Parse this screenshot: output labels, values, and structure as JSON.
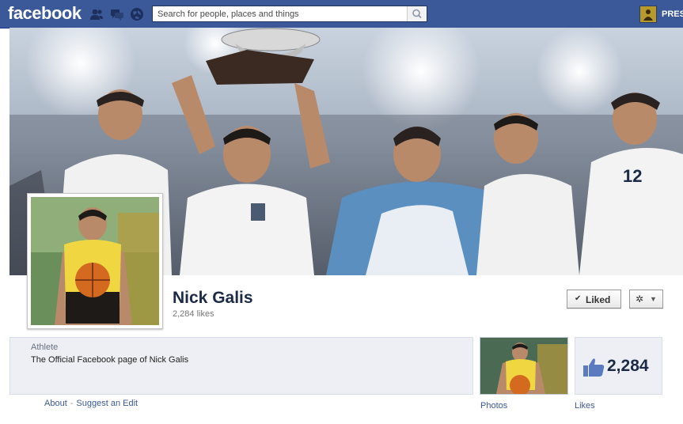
{
  "topbar": {
    "logo": "facebook",
    "search_placeholder": "Search for people, places and things",
    "user_name": "PRES",
    "icons": [
      "friend-requests-icon",
      "messages-icon",
      "notifications-icon",
      "search-icon"
    ]
  },
  "page": {
    "name": "Nick Galis",
    "likes_text": "2,284 likes",
    "liked_button": "Liked",
    "category": "Athlete",
    "description": "The Official Facebook page of Nick Galis",
    "links": {
      "about": "About",
      "separator": "-",
      "suggest": "Suggest an Edit"
    },
    "photos_label": "Photos",
    "likes_label": "Likes",
    "likes_number": "2,284"
  },
  "colors": {
    "brand_blue": "#3b5998",
    "dark_text": "#1c2a47",
    "panel_bg": "#edeff4"
  }
}
